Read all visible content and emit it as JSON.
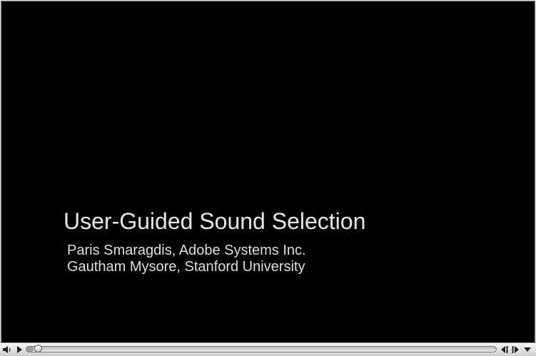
{
  "slide": {
    "title": "User-Guided Sound Selection",
    "author_line1": "Paris Smaragdis, Adobe Systems Inc.",
    "author_line2": "Gautham Mysore, Stanford University"
  },
  "controls": {
    "progress": 0.015,
    "icons": [
      "speaker-icon",
      "play-icon",
      "step-back-icon",
      "step-forward-icon",
      "menu-arrow-icon"
    ]
  }
}
